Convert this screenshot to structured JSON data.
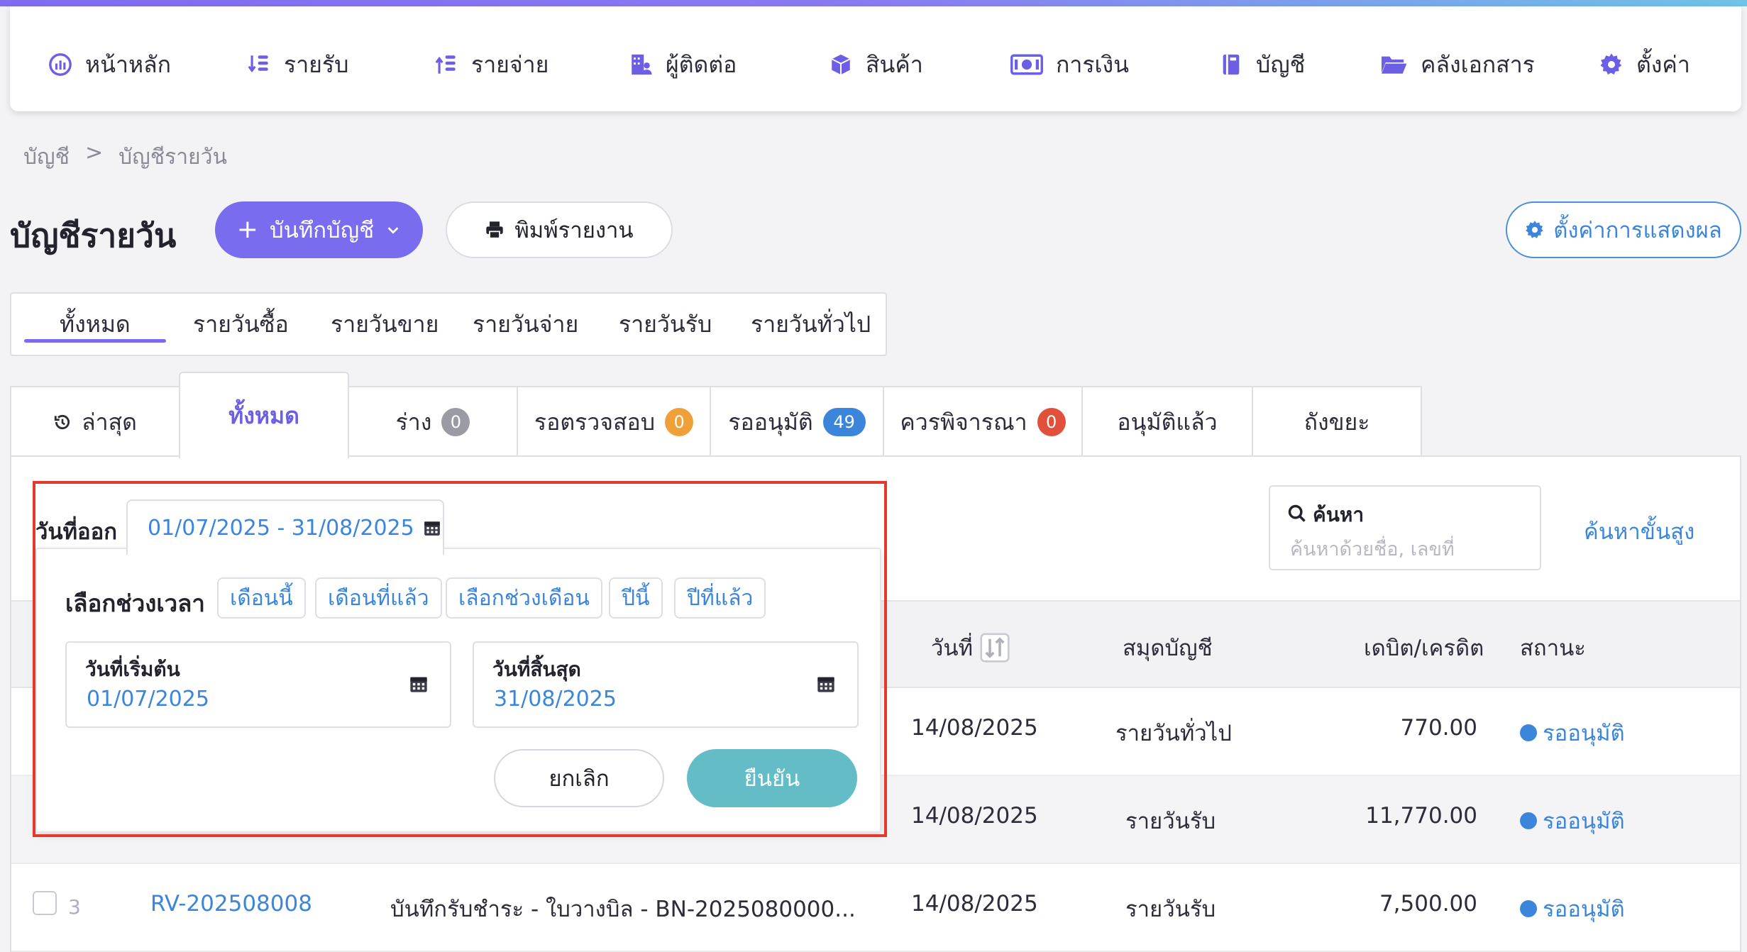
{
  "nav": {
    "items": [
      {
        "label": "หน้าหลัก",
        "icon": "dashboard-icon"
      },
      {
        "label": "รายรับ",
        "icon": "income-icon"
      },
      {
        "label": "รายจ่าย",
        "icon": "expense-icon"
      },
      {
        "label": "ผู้ติดต่อ",
        "icon": "contacts-icon"
      },
      {
        "label": "สินค้า",
        "icon": "product-box-icon"
      },
      {
        "label": "การเงิน",
        "icon": "money-icon"
      },
      {
        "label": "บัญชี",
        "icon": "ledger-book-icon"
      },
      {
        "label": "คลังเอกสาร",
        "icon": "folder-icon"
      },
      {
        "label": "ตั้งค่า",
        "icon": "gear-icon"
      }
    ]
  },
  "breadcrumb": {
    "parent": "บัญชี",
    "separator": ">",
    "current": "บัญชีรายวัน"
  },
  "page": {
    "title": "บัญชีรายวัน",
    "record_button": "บันทึกบัญชี",
    "print_button": "พิมพ์รายงาน",
    "display_settings_button": "ตั้งค่าการแสดงผล"
  },
  "journal_tabs": [
    "ทั้งหมด",
    "รายวันซื้อ",
    "รายวันขาย",
    "รายวันจ่าย",
    "รายวันรับ",
    "รายวันทั่วไป"
  ],
  "status_tabs": {
    "latest": "ล่าสุด",
    "all": "ทั้งหมด",
    "draft": {
      "label": "ร่าง",
      "count": "0"
    },
    "review": {
      "label": "รอตรวจสอบ",
      "count": "0"
    },
    "awaiting": {
      "label": "รออนุมัติ",
      "count": "49"
    },
    "consider": {
      "label": "ควรพิจารณา",
      "count": "0"
    },
    "approved": "อนุมัติแล้ว",
    "trash": "ถังขยะ"
  },
  "filter": {
    "date_label": "วันที่ออก",
    "date_range": "01/07/2025 - 31/08/2025",
    "search_label": "ค้นหา",
    "search_placeholder": "ค้นหาด้วยชื่อ, เลขที่",
    "advanced_search": "ค้นหาขั้นสูง"
  },
  "date_popup": {
    "title": "เลือกช่วงเวลา",
    "presets": [
      "เดือนนี้",
      "เดือนที่แล้ว",
      "เลือกช่วงเดือน",
      "ปีนี้",
      "ปีที่แล้ว"
    ],
    "start_label": "วันที่เริ่มต้น",
    "start_value": "01/07/2025",
    "end_label": "วันที่สิ้นสุด",
    "end_value": "31/08/2025",
    "cancel": "ยกเลิก",
    "confirm": "ยืนยัน"
  },
  "table": {
    "headers": {
      "date": "วันที่",
      "journal": "สมุดบัญชี",
      "amount": "เดบิต/เครดิต",
      "status": "สถานะ"
    },
    "rows": [
      {
        "date": "14/08/2025",
        "journal": "รายวันทั่วไป",
        "amount": "770.00",
        "status": "รออนุมัติ"
      },
      {
        "date": "14/08/2025",
        "journal": "รายวันรับ",
        "amount": "11,770.00",
        "status": "รออนุมัติ"
      },
      {
        "index": "3",
        "doc_no": "RV-202508008",
        "description": "บันทึกรับชำระ - ใบวางบิล - BN-2025080000...",
        "date": "14/08/2025",
        "journal": "รายวันรับ",
        "amount": "7,500.00",
        "status": "รออนุมัติ"
      }
    ]
  },
  "colors": {
    "primary": "#7a6cee",
    "link": "#3b86db",
    "confirm": "#63bcc6",
    "highlight": "#e23b2c",
    "badge_gray": "#9b9ba6",
    "badge_orange": "#f0a038",
    "badge_blue": "#3b86db",
    "badge_red": "#e0503a"
  }
}
